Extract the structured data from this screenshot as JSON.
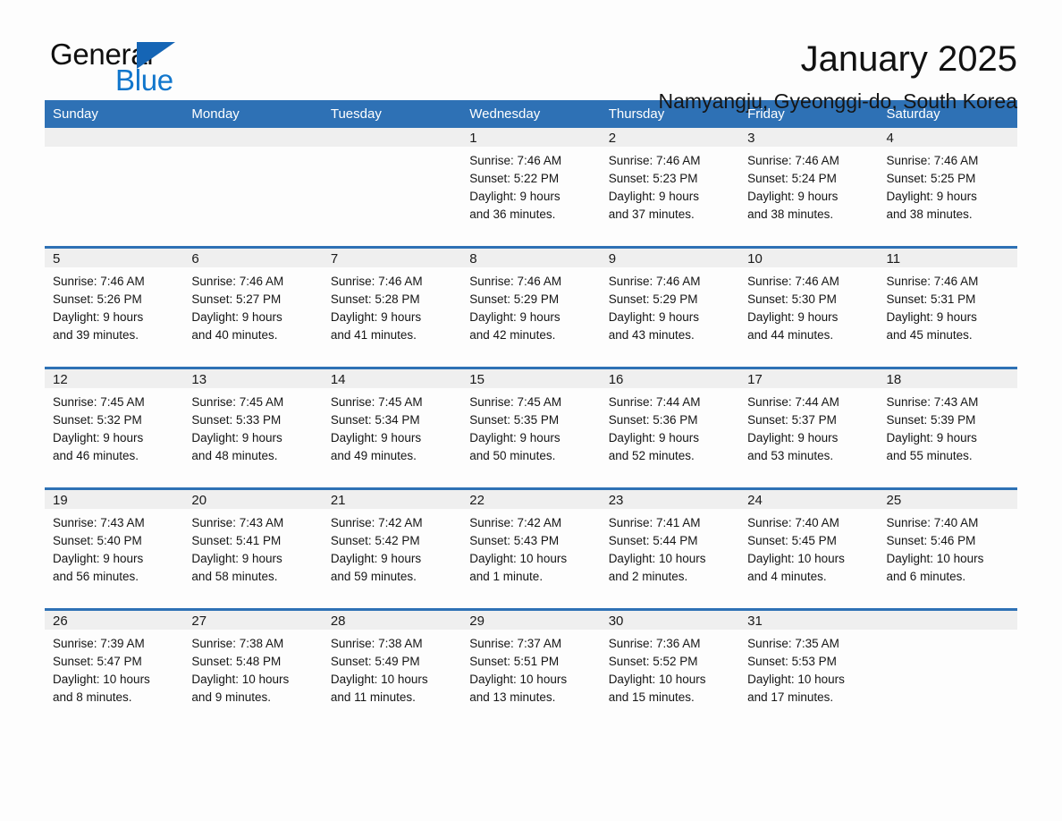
{
  "brand": {
    "name_part1": "General",
    "name_part2": "Blue",
    "triangle_icon": "blue-triangle-logo-mark",
    "accent_color": "#1565b5",
    "blue_text_color": "#1176cc"
  },
  "header": {
    "month_title": "January 2025",
    "location": "Namyangju, Gyeonggi-do, South Korea"
  },
  "theme": {
    "header_row_color": "#2e71b5",
    "day_number_band_color": "#efefef",
    "page_background": "#fdfdfd",
    "text_color": "#1a1a1a"
  },
  "weekday_headers": [
    "Sunday",
    "Monday",
    "Tuesday",
    "Wednesday",
    "Thursday",
    "Friday",
    "Saturday"
  ],
  "weeks": [
    [
      {
        "day": "",
        "sunrise": "",
        "sunset": "",
        "daylight_line1": "",
        "daylight_line2": ""
      },
      {
        "day": "",
        "sunrise": "",
        "sunset": "",
        "daylight_line1": "",
        "daylight_line2": ""
      },
      {
        "day": "",
        "sunrise": "",
        "sunset": "",
        "daylight_line1": "",
        "daylight_line2": ""
      },
      {
        "day": "1",
        "sunrise": "Sunrise: 7:46 AM",
        "sunset": "Sunset: 5:22 PM",
        "daylight_line1": "Daylight: 9 hours",
        "daylight_line2": "and 36 minutes."
      },
      {
        "day": "2",
        "sunrise": "Sunrise: 7:46 AM",
        "sunset": "Sunset: 5:23 PM",
        "daylight_line1": "Daylight: 9 hours",
        "daylight_line2": "and 37 minutes."
      },
      {
        "day": "3",
        "sunrise": "Sunrise: 7:46 AM",
        "sunset": "Sunset: 5:24 PM",
        "daylight_line1": "Daylight: 9 hours",
        "daylight_line2": "and 38 minutes."
      },
      {
        "day": "4",
        "sunrise": "Sunrise: 7:46 AM",
        "sunset": "Sunset: 5:25 PM",
        "daylight_line1": "Daylight: 9 hours",
        "daylight_line2": "and 38 minutes."
      }
    ],
    [
      {
        "day": "5",
        "sunrise": "Sunrise: 7:46 AM",
        "sunset": "Sunset: 5:26 PM",
        "daylight_line1": "Daylight: 9 hours",
        "daylight_line2": "and 39 minutes."
      },
      {
        "day": "6",
        "sunrise": "Sunrise: 7:46 AM",
        "sunset": "Sunset: 5:27 PM",
        "daylight_line1": "Daylight: 9 hours",
        "daylight_line2": "and 40 minutes."
      },
      {
        "day": "7",
        "sunrise": "Sunrise: 7:46 AM",
        "sunset": "Sunset: 5:28 PM",
        "daylight_line1": "Daylight: 9 hours",
        "daylight_line2": "and 41 minutes."
      },
      {
        "day": "8",
        "sunrise": "Sunrise: 7:46 AM",
        "sunset": "Sunset: 5:29 PM",
        "daylight_line1": "Daylight: 9 hours",
        "daylight_line2": "and 42 minutes."
      },
      {
        "day": "9",
        "sunrise": "Sunrise: 7:46 AM",
        "sunset": "Sunset: 5:29 PM",
        "daylight_line1": "Daylight: 9 hours",
        "daylight_line2": "and 43 minutes."
      },
      {
        "day": "10",
        "sunrise": "Sunrise: 7:46 AM",
        "sunset": "Sunset: 5:30 PM",
        "daylight_line1": "Daylight: 9 hours",
        "daylight_line2": "and 44 minutes."
      },
      {
        "day": "11",
        "sunrise": "Sunrise: 7:46 AM",
        "sunset": "Sunset: 5:31 PM",
        "daylight_line1": "Daylight: 9 hours",
        "daylight_line2": "and 45 minutes."
      }
    ],
    [
      {
        "day": "12",
        "sunrise": "Sunrise: 7:45 AM",
        "sunset": "Sunset: 5:32 PM",
        "daylight_line1": "Daylight: 9 hours",
        "daylight_line2": "and 46 minutes."
      },
      {
        "day": "13",
        "sunrise": "Sunrise: 7:45 AM",
        "sunset": "Sunset: 5:33 PM",
        "daylight_line1": "Daylight: 9 hours",
        "daylight_line2": "and 48 minutes."
      },
      {
        "day": "14",
        "sunrise": "Sunrise: 7:45 AM",
        "sunset": "Sunset: 5:34 PM",
        "daylight_line1": "Daylight: 9 hours",
        "daylight_line2": "and 49 minutes."
      },
      {
        "day": "15",
        "sunrise": "Sunrise: 7:45 AM",
        "sunset": "Sunset: 5:35 PM",
        "daylight_line1": "Daylight: 9 hours",
        "daylight_line2": "and 50 minutes."
      },
      {
        "day": "16",
        "sunrise": "Sunrise: 7:44 AM",
        "sunset": "Sunset: 5:36 PM",
        "daylight_line1": "Daylight: 9 hours",
        "daylight_line2": "and 52 minutes."
      },
      {
        "day": "17",
        "sunrise": "Sunrise: 7:44 AM",
        "sunset": "Sunset: 5:37 PM",
        "daylight_line1": "Daylight: 9 hours",
        "daylight_line2": "and 53 minutes."
      },
      {
        "day": "18",
        "sunrise": "Sunrise: 7:43 AM",
        "sunset": "Sunset: 5:39 PM",
        "daylight_line1": "Daylight: 9 hours",
        "daylight_line2": "and 55 minutes."
      }
    ],
    [
      {
        "day": "19",
        "sunrise": "Sunrise: 7:43 AM",
        "sunset": "Sunset: 5:40 PM",
        "daylight_line1": "Daylight: 9 hours",
        "daylight_line2": "and 56 minutes."
      },
      {
        "day": "20",
        "sunrise": "Sunrise: 7:43 AM",
        "sunset": "Sunset: 5:41 PM",
        "daylight_line1": "Daylight: 9 hours",
        "daylight_line2": "and 58 minutes."
      },
      {
        "day": "21",
        "sunrise": "Sunrise: 7:42 AM",
        "sunset": "Sunset: 5:42 PM",
        "daylight_line1": "Daylight: 9 hours",
        "daylight_line2": "and 59 minutes."
      },
      {
        "day": "22",
        "sunrise": "Sunrise: 7:42 AM",
        "sunset": "Sunset: 5:43 PM",
        "daylight_line1": "Daylight: 10 hours",
        "daylight_line2": "and 1 minute."
      },
      {
        "day": "23",
        "sunrise": "Sunrise: 7:41 AM",
        "sunset": "Sunset: 5:44 PM",
        "daylight_line1": "Daylight: 10 hours",
        "daylight_line2": "and 2 minutes."
      },
      {
        "day": "24",
        "sunrise": "Sunrise: 7:40 AM",
        "sunset": "Sunset: 5:45 PM",
        "daylight_line1": "Daylight: 10 hours",
        "daylight_line2": "and 4 minutes."
      },
      {
        "day": "25",
        "sunrise": "Sunrise: 7:40 AM",
        "sunset": "Sunset: 5:46 PM",
        "daylight_line1": "Daylight: 10 hours",
        "daylight_line2": "and 6 minutes."
      }
    ],
    [
      {
        "day": "26",
        "sunrise": "Sunrise: 7:39 AM",
        "sunset": "Sunset: 5:47 PM",
        "daylight_line1": "Daylight: 10 hours",
        "daylight_line2": "and 8 minutes."
      },
      {
        "day": "27",
        "sunrise": "Sunrise: 7:38 AM",
        "sunset": "Sunset: 5:48 PM",
        "daylight_line1": "Daylight: 10 hours",
        "daylight_line2": "and 9 minutes."
      },
      {
        "day": "28",
        "sunrise": "Sunrise: 7:38 AM",
        "sunset": "Sunset: 5:49 PM",
        "daylight_line1": "Daylight: 10 hours",
        "daylight_line2": "and 11 minutes."
      },
      {
        "day": "29",
        "sunrise": "Sunrise: 7:37 AM",
        "sunset": "Sunset: 5:51 PM",
        "daylight_line1": "Daylight: 10 hours",
        "daylight_line2": "and 13 minutes."
      },
      {
        "day": "30",
        "sunrise": "Sunrise: 7:36 AM",
        "sunset": "Sunset: 5:52 PM",
        "daylight_line1": "Daylight: 10 hours",
        "daylight_line2": "and 15 minutes."
      },
      {
        "day": "31",
        "sunrise": "Sunrise: 7:35 AM",
        "sunset": "Sunset: 5:53 PM",
        "daylight_line1": "Daylight: 10 hours",
        "daylight_line2": "and 17 minutes."
      },
      {
        "day": "",
        "sunrise": "",
        "sunset": "",
        "daylight_line1": "",
        "daylight_line2": ""
      }
    ]
  ]
}
